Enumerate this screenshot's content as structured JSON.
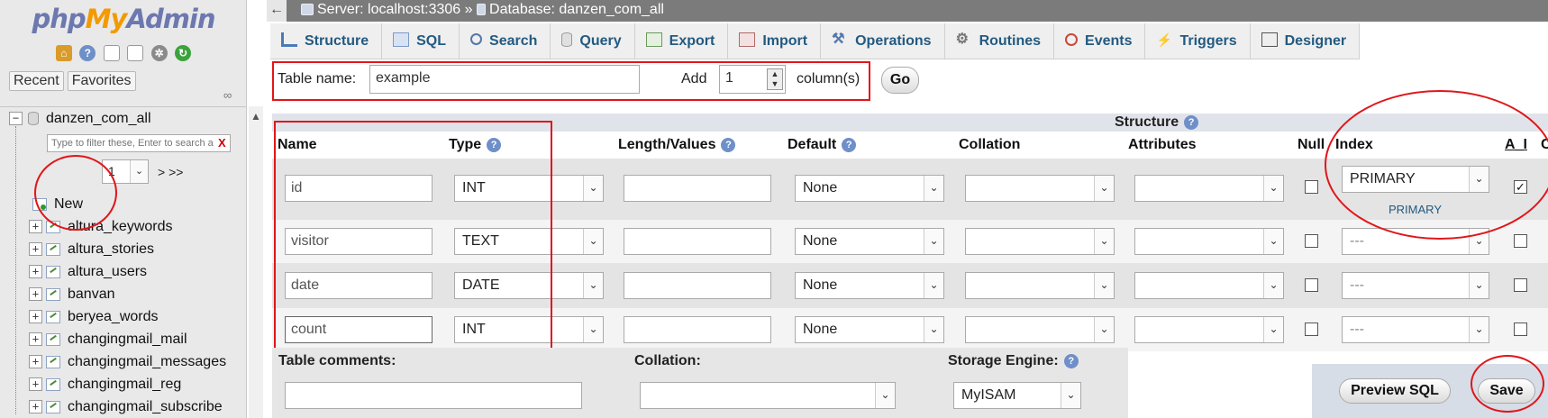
{
  "logo": {
    "php": "php",
    "my": "My",
    "admin": "Admin"
  },
  "nav": {
    "recent": "Recent",
    "favorites": "Favorites",
    "database": "danzen_com_all",
    "filter_placeholder": "Type to filter these, Enter to search a",
    "filter_clear": "X",
    "page_value": "1",
    "page_more": "> >>",
    "new_label": "New",
    "tables": [
      "altura_keywords",
      "altura_stories",
      "altura_users",
      "banvan",
      "beryea_words",
      "changingmail_mail",
      "changingmail_messages",
      "changingmail_reg",
      "changingmail_subscribe"
    ]
  },
  "breadcrumb": {
    "back": "←",
    "server": "Server: localhost:3306",
    "sep": "»",
    "database": "Database: danzen_com_all"
  },
  "tabs": [
    {
      "label": "Structure",
      "icon": "structure-icon"
    },
    {
      "label": "SQL",
      "icon": "sql-icon"
    },
    {
      "label": "Search",
      "icon": "search-icon"
    },
    {
      "label": "Query",
      "icon": "query-icon"
    },
    {
      "label": "Export",
      "icon": "export-icon"
    },
    {
      "label": "Import",
      "icon": "import-icon"
    },
    {
      "label": "Operations",
      "icon": "wrench-icon"
    },
    {
      "label": "Routines",
      "icon": "routines-icon"
    },
    {
      "label": "Events",
      "icon": "clock-icon"
    },
    {
      "label": "Triggers",
      "icon": "triggers-icon"
    },
    {
      "label": "Designer",
      "icon": "designer-icon"
    }
  ],
  "form": {
    "table_name_label": "Table name:",
    "table_name_value": "example",
    "add_label": "Add",
    "add_value": "1",
    "columns_label": "column(s)",
    "go": "Go"
  },
  "structure": {
    "title": "Structure",
    "headers": {
      "name": "Name",
      "type": "Type",
      "length": "Length/Values",
      "default": "Default",
      "collation": "Collation",
      "attributes": "Attributes",
      "null": "Null",
      "index": "Index",
      "ai": "A_I",
      "comments": "C"
    },
    "rows": [
      {
        "name": "id",
        "type": "INT",
        "length": "",
        "default": "None",
        "collation": "",
        "attributes": "",
        "null": false,
        "index": "PRIMARY",
        "index_link": "PRIMARY",
        "ai": true
      },
      {
        "name": "visitor",
        "type": "TEXT",
        "length": "",
        "default": "None",
        "collation": "",
        "attributes": "",
        "null": false,
        "index": "---",
        "ai": false
      },
      {
        "name": "date",
        "type": "DATE",
        "length": "",
        "default": "None",
        "collation": "",
        "attributes": "",
        "null": false,
        "index": "---",
        "ai": false
      },
      {
        "name": "count",
        "type": "INT",
        "length": "",
        "default": "None",
        "collation": "",
        "attributes": "",
        "null": false,
        "index": "---",
        "ai": false
      }
    ]
  },
  "footer": {
    "comments_label": "Table comments:",
    "collation_label": "Collation:",
    "engine_label": "Storage Engine:",
    "engine_value": "MyISAM",
    "preview_sql": "Preview SQL",
    "save": "Save"
  },
  "colors": {
    "accent": "#235a81",
    "annotation_red": "#e0161a"
  }
}
